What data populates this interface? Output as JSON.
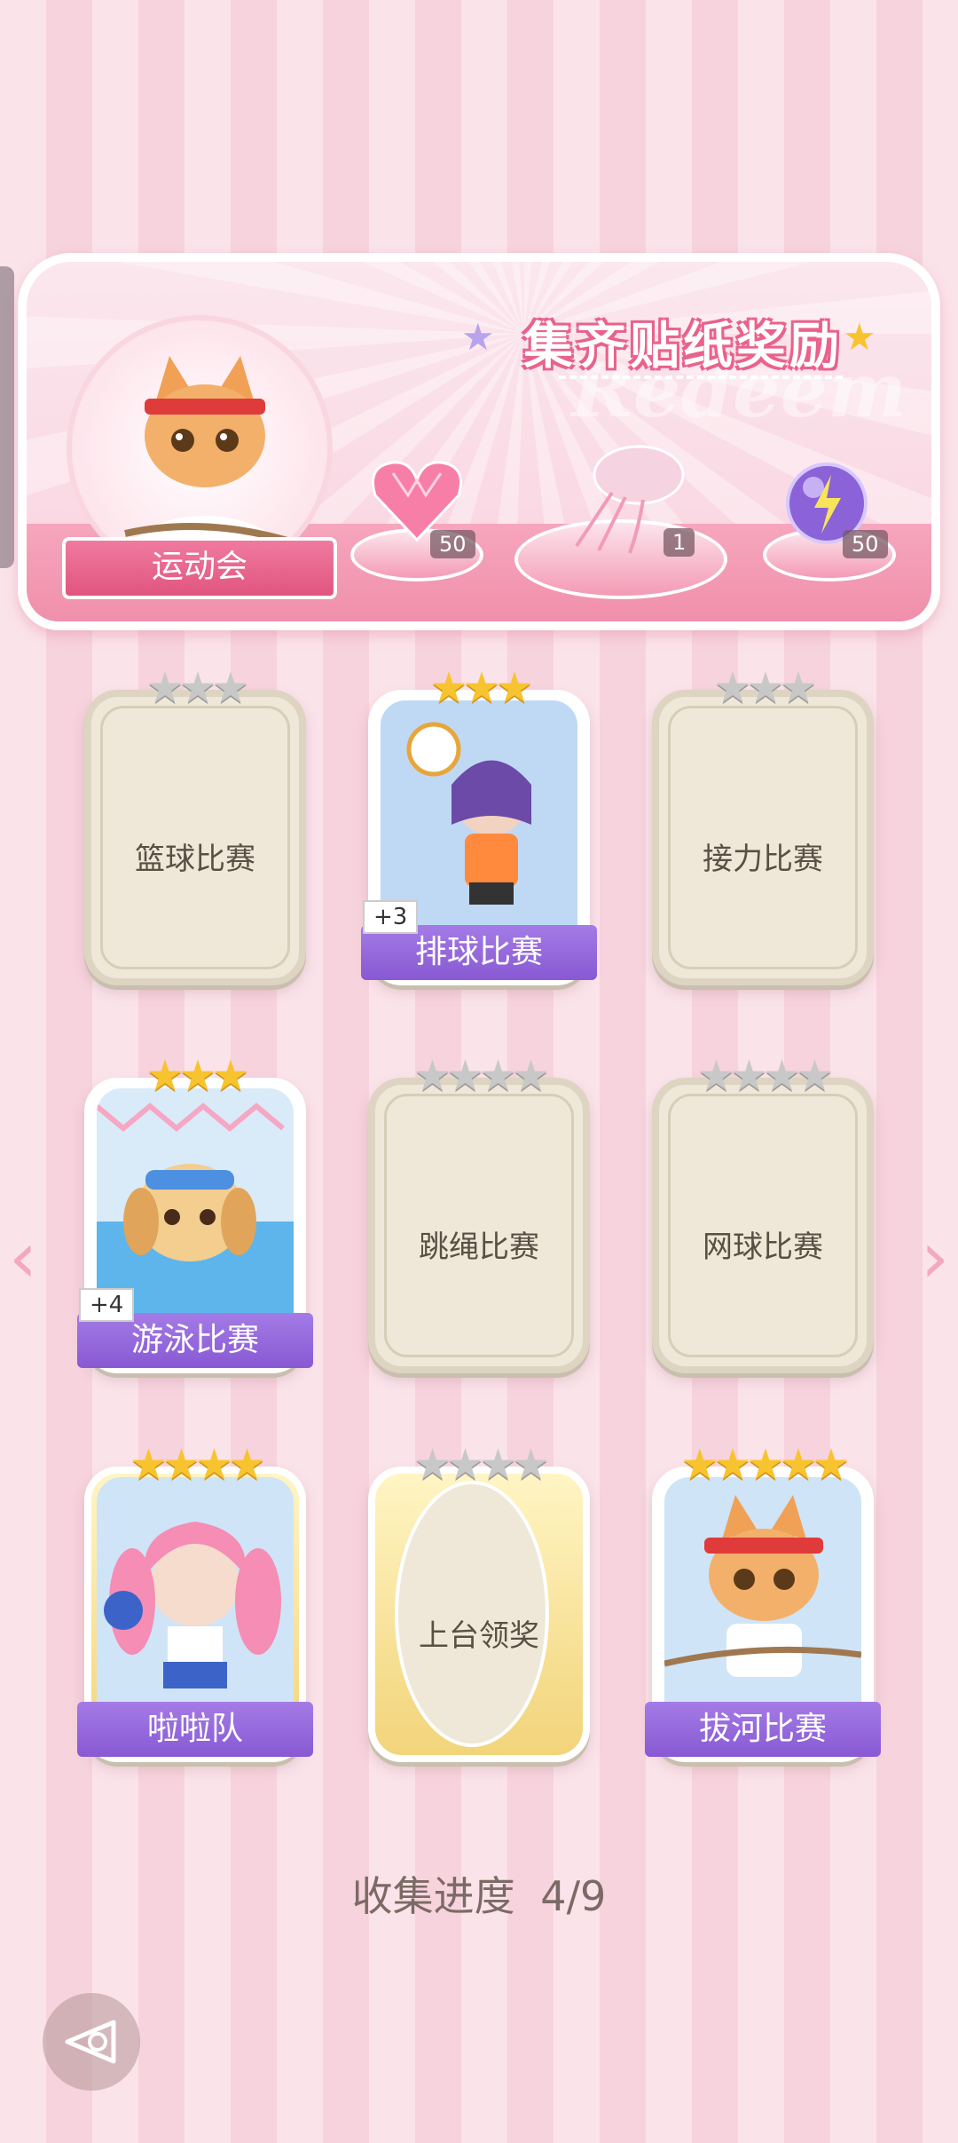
{
  "banner": {
    "title": "集齐贴纸奖励",
    "watermark": "Redeem",
    "event_name": "运动会",
    "rewards": [
      {
        "icon": "pink-heart-gem-icon",
        "count": "50"
      },
      {
        "icon": "jellyfish-decoration-icon",
        "count": "1"
      },
      {
        "icon": "purple-lightning-orb-icon",
        "count": "50"
      }
    ]
  },
  "cards": [
    {
      "name": "篮球比赛",
      "stars": 3,
      "stars_earned": 0,
      "unlocked": false
    },
    {
      "name": "排球比赛",
      "stars": 3,
      "stars_earned": 3,
      "unlocked": true,
      "bonus": "+3"
    },
    {
      "name": "接力比赛",
      "stars": 3,
      "stars_earned": 0,
      "unlocked": false
    },
    {
      "name": "游泳比赛",
      "stars": 3,
      "stars_earned": 3,
      "unlocked": true,
      "bonus": "+4"
    },
    {
      "name": "跳绳比赛",
      "stars": 4,
      "stars_earned": 0,
      "unlocked": false
    },
    {
      "name": "网球比赛",
      "stars": 4,
      "stars_earned": 0,
      "unlocked": false
    },
    {
      "name": "啦啦队",
      "stars": 4,
      "stars_earned": 4,
      "unlocked": true
    },
    {
      "name": "上台领奖",
      "stars": 4,
      "stars_earned": 0,
      "unlocked": false
    },
    {
      "name": "拔河比赛",
      "stars": 5,
      "stars_earned": 5,
      "unlocked": true
    }
  ],
  "progress": {
    "label": "收集进度",
    "value": "4/9"
  },
  "nav": {
    "prev_icon": "chevron-left-icon",
    "next_icon": "chevron-right-icon",
    "back_icon": "back-arrow-icon"
  },
  "colors": {
    "accent_pink": "#e9628c",
    "ribbon_purple": "#8859d3",
    "star_gold": "#f7c430",
    "star_gray": "#c8c8c8"
  }
}
